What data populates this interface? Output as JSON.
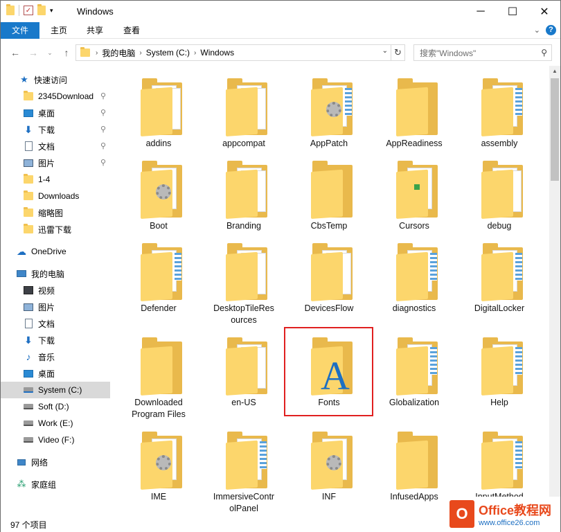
{
  "window": {
    "title": "Windows"
  },
  "ribbon": {
    "tabs": [
      "文件",
      "主页",
      "共享",
      "查看"
    ]
  },
  "nav": {
    "path": [
      "我的电脑",
      "System (C:)",
      "Windows"
    ],
    "search_placeholder": "搜索\"Windows\""
  },
  "sidebar": {
    "quick_access": "快速访问",
    "pinned": [
      {
        "label": "2345Download",
        "icon": "folder-icon",
        "pinned": true
      },
      {
        "label": "桌面",
        "icon": "desktop-icon",
        "pinned": true
      },
      {
        "label": "下载",
        "icon": "download-icon",
        "pinned": true
      },
      {
        "label": "文档",
        "icon": "document-icon",
        "pinned": true
      },
      {
        "label": "图片",
        "icon": "pictures-icon",
        "pinned": true
      },
      {
        "label": "1-4",
        "icon": "folder-icon",
        "pinned": false
      },
      {
        "label": "Downloads",
        "icon": "folder-icon",
        "pinned": false
      },
      {
        "label": "缩略图",
        "icon": "folder-icon",
        "pinned": false
      },
      {
        "label": "迅雷下载",
        "icon": "folder-icon",
        "pinned": false
      }
    ],
    "onedrive": "OneDrive",
    "this_pc": "我的电脑",
    "pc_items": [
      {
        "label": "视频",
        "icon": "video-icon"
      },
      {
        "label": "图片",
        "icon": "pictures-icon"
      },
      {
        "label": "文档",
        "icon": "document-icon"
      },
      {
        "label": "下载",
        "icon": "download-icon"
      },
      {
        "label": "音乐",
        "icon": "music-icon"
      },
      {
        "label": "桌面",
        "icon": "desktop-icon"
      },
      {
        "label": "System (C:)",
        "icon": "system-drive-icon",
        "selected": true
      },
      {
        "label": "Soft (D:)",
        "icon": "drive-icon"
      },
      {
        "label": "Work (E:)",
        "icon": "drive-icon"
      },
      {
        "label": "Video (F:)",
        "icon": "drive-icon"
      }
    ],
    "network": "网络",
    "homegroup": "家庭组"
  },
  "folders": [
    {
      "name": "addins",
      "style": "paper"
    },
    {
      "name": "appcompat",
      "style": "paper"
    },
    {
      "name": "AppPatch",
      "style": "gear-stripes"
    },
    {
      "name": "AppReadiness",
      "style": "plain"
    },
    {
      "name": "assembly",
      "style": "stripes"
    },
    {
      "name": "Boot",
      "style": "gear"
    },
    {
      "name": "Branding",
      "style": "paper"
    },
    {
      "name": "CbsTemp",
      "style": "plain"
    },
    {
      "name": "Cursors",
      "style": "green"
    },
    {
      "name": "debug",
      "style": "text"
    },
    {
      "name": "Defender",
      "style": "stripes"
    },
    {
      "name": "DesktopTileResources",
      "style": "paper"
    },
    {
      "name": "DevicesFlow",
      "style": "paper"
    },
    {
      "name": "diagnostics",
      "style": "stripes"
    },
    {
      "name": "DigitalLocker",
      "style": "stripes"
    },
    {
      "name": "Downloaded Program Files",
      "style": "plain"
    },
    {
      "name": "en-US",
      "style": "paper"
    },
    {
      "name": "Fonts",
      "style": "fonts"
    },
    {
      "name": "Globalization",
      "style": "stripes"
    },
    {
      "name": "Help",
      "style": "stripes"
    },
    {
      "name": "IME",
      "style": "gear"
    },
    {
      "name": "ImmersiveControlPanel",
      "style": "stripes"
    },
    {
      "name": "INF",
      "style": "gear"
    },
    {
      "name": "InfusedApps",
      "style": "plain"
    },
    {
      "name": "InputMethod",
      "style": "stripes"
    }
  ],
  "folder_label_lines": {
    "DesktopTileResources": [
      "DesktopTileRes",
      "ources"
    ],
    "Downloaded Program Files": [
      "Downloaded",
      "Program Files"
    ],
    "ImmersiveControlPanel": [
      "ImmersiveContr",
      "olPanel"
    ]
  },
  "status": {
    "item_count": "97 个项目"
  },
  "watermark": {
    "brand": "Office教程网",
    "url": "www.office26.com"
  },
  "colors": {
    "accent": "#1979ca",
    "folder": "#fcd66c",
    "highlight": "#e02020"
  }
}
